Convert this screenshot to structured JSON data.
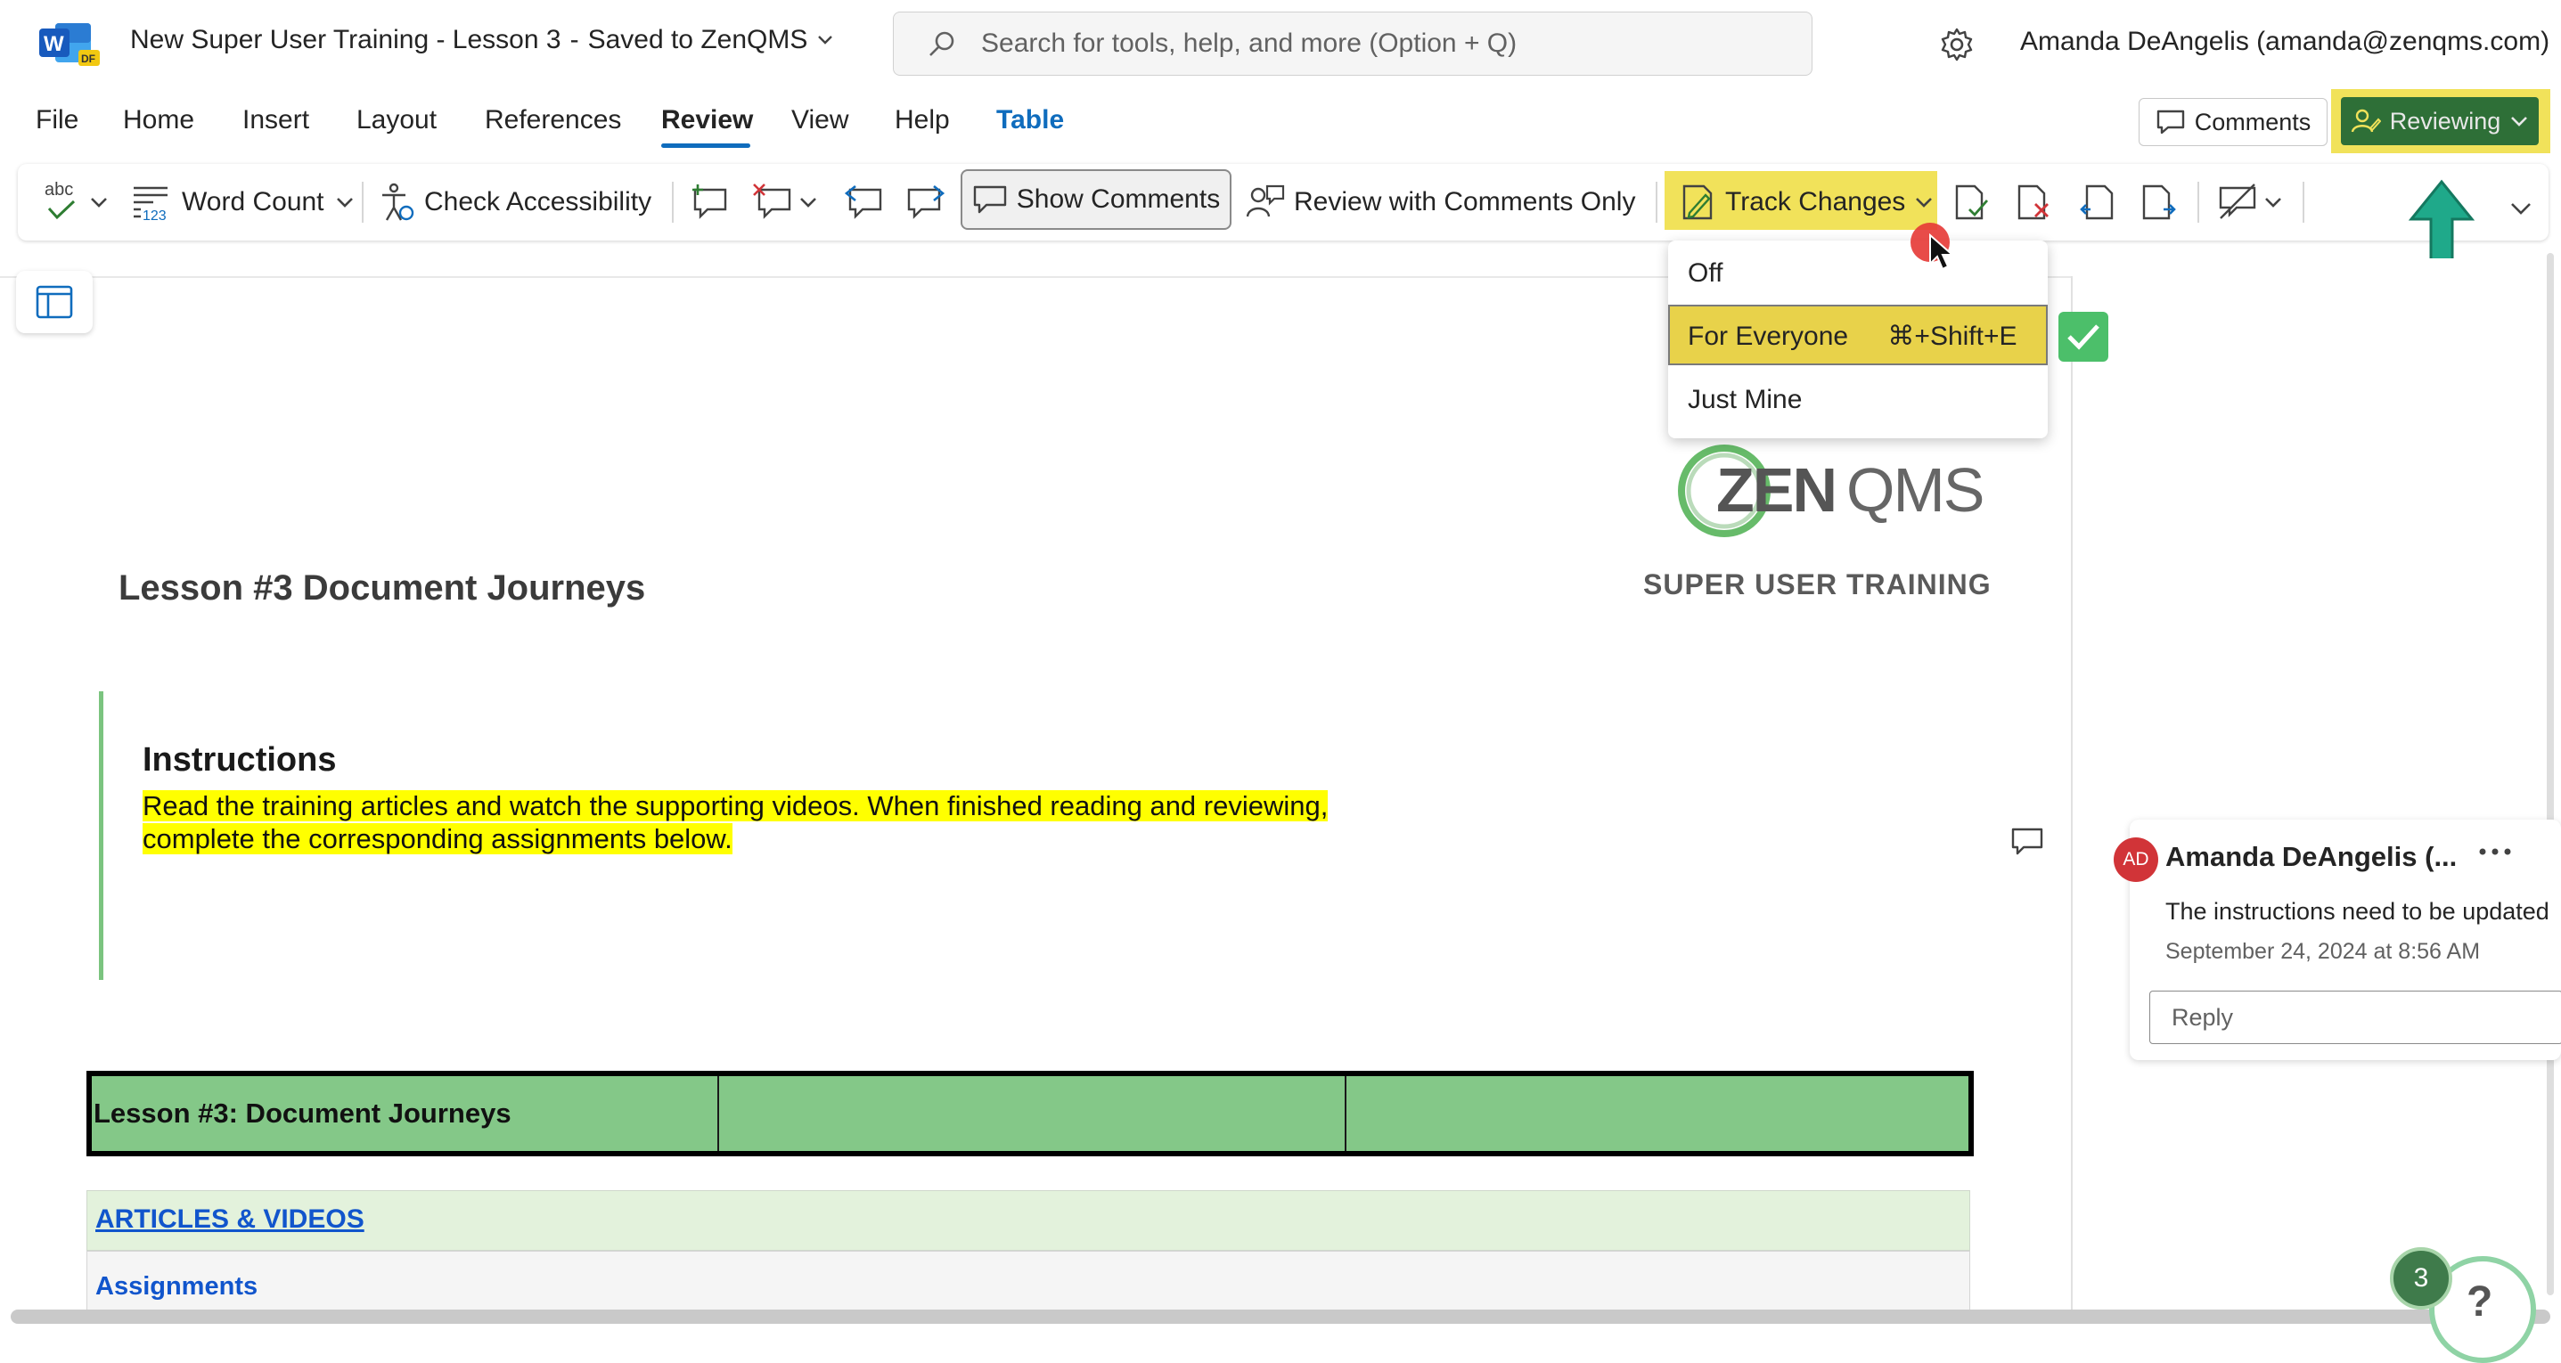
{
  "app": {
    "doc_title": "New Super User Training - Lesson 3",
    "save_status": "Saved to ZenQMS",
    "search_placeholder": "Search for tools, help, and more (Option + Q)",
    "user": "Amanda DeAngelis (amanda@zenqms.com)"
  },
  "menu": {
    "tabs": [
      "File",
      "Home",
      "Insert",
      "Layout",
      "References",
      "Review",
      "View",
      "Help",
      "Table"
    ],
    "active_tab": "Review",
    "comments_button": "Comments",
    "reviewing_button": "Reviewing"
  },
  "ribbon": {
    "spelling_label": "abc",
    "word_count": "Word Count",
    "check_accessibility": "Check Accessibility",
    "show_comments": "Show Comments",
    "review_with_comments_only": "Review with Comments Only",
    "track_changes": "Track Changes"
  },
  "track_changes_menu": {
    "items": [
      {
        "label": "Off",
        "shortcut": ""
      },
      {
        "label": "For Everyone",
        "shortcut": "⌘+Shift+E"
      },
      {
        "label": "Just Mine",
        "shortcut": ""
      }
    ],
    "selected": "For Everyone"
  },
  "document": {
    "heading": "Lesson #3 Document Journeys",
    "logo_text_zen": "ZEN",
    "logo_text_qms": "QMS",
    "logo_subtitle": "SUPER USER TRAINING",
    "instructions_title": "Instructions",
    "instructions_line1": "Read the training articles and watch the supporting videos. When finished reading and reviewing,",
    "instructions_line2": "complete the corresponding assignments below.",
    "table_header": "Lesson #3: Document Journeys",
    "row_articles": "ARTICLES & VIDEOS",
    "row_assignments": "Assignments"
  },
  "comment": {
    "initials": "AD",
    "author": "Amanda DeAngelis (...",
    "text": "The instructions need to be updated",
    "date": "September 24, 2024 at 8:56 AM",
    "reply_placeholder": "Reply"
  },
  "badges": {
    "notification_count": "3",
    "help": "?"
  },
  "colors": {
    "highlight_yellow": "#f1e25a",
    "reviewing_green": "#2e6f37",
    "word_blue": "#0f6cbd",
    "table_green": "#84c888",
    "avatar_red": "#d13438"
  }
}
